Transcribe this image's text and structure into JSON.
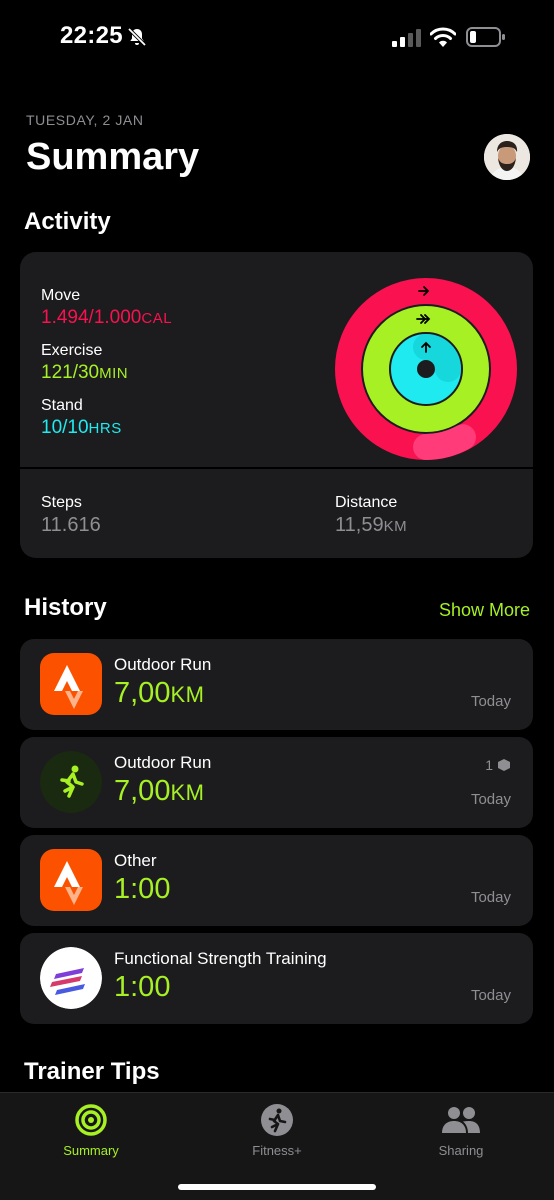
{
  "status_bar": {
    "time": "22:25",
    "icons": [
      "bell-slash-icon",
      "signal-icon",
      "wifi-icon",
      "battery-icon"
    ]
  },
  "header": {
    "date": "TUESDAY, 2 JAN",
    "title": "Summary"
  },
  "activity": {
    "section_title": "Activity",
    "move": {
      "label": "Move",
      "value": "1.494/1.000",
      "unit": "CAL",
      "color": "#fa114f"
    },
    "exercise": {
      "label": "Exercise",
      "value": "121/30",
      "unit": "MIN",
      "color": "#a6f024"
    },
    "stand": {
      "label": "Stand",
      "value": "10/10",
      "unit": "HRS",
      "color": "#1eeaef"
    },
    "rings_progress": {
      "move": 1.494,
      "exercise": 4.03,
      "stand": 1.0
    },
    "steps": {
      "label": "Steps",
      "value": "11.616"
    },
    "distance": {
      "label": "Distance",
      "value": "11,59",
      "unit": "KM"
    }
  },
  "history": {
    "section_title": "History",
    "show_more": "Show More",
    "rows": [
      {
        "title": "Outdoor Run",
        "value": "7,00",
        "unit": "KM",
        "date": "Today",
        "icon": "strava-icon"
      },
      {
        "title": "Outdoor Run",
        "value": "7,00",
        "unit": "KM",
        "date": "Today",
        "badge": "1",
        "icon": "outdoor-run-icon"
      },
      {
        "title": "Other",
        "value": "1:00",
        "unit": "",
        "date": "Today",
        "icon": "strava-icon"
      },
      {
        "title": "Functional Strength Training",
        "value": "1:00",
        "unit": "",
        "date": "Today",
        "icon": "training-app-icon"
      }
    ]
  },
  "trainer_tips": {
    "section_title": "Trainer Tips"
  },
  "tab_bar": {
    "tabs": [
      {
        "label": "Summary",
        "active": true
      },
      {
        "label": "Fitness+",
        "active": false
      },
      {
        "label": "Sharing",
        "active": false
      }
    ]
  },
  "colors": {
    "accent": "#a6f024",
    "move": "#fa114f",
    "exercise": "#a6f024",
    "stand": "#1eeaef",
    "card": "#1c1c1e"
  }
}
